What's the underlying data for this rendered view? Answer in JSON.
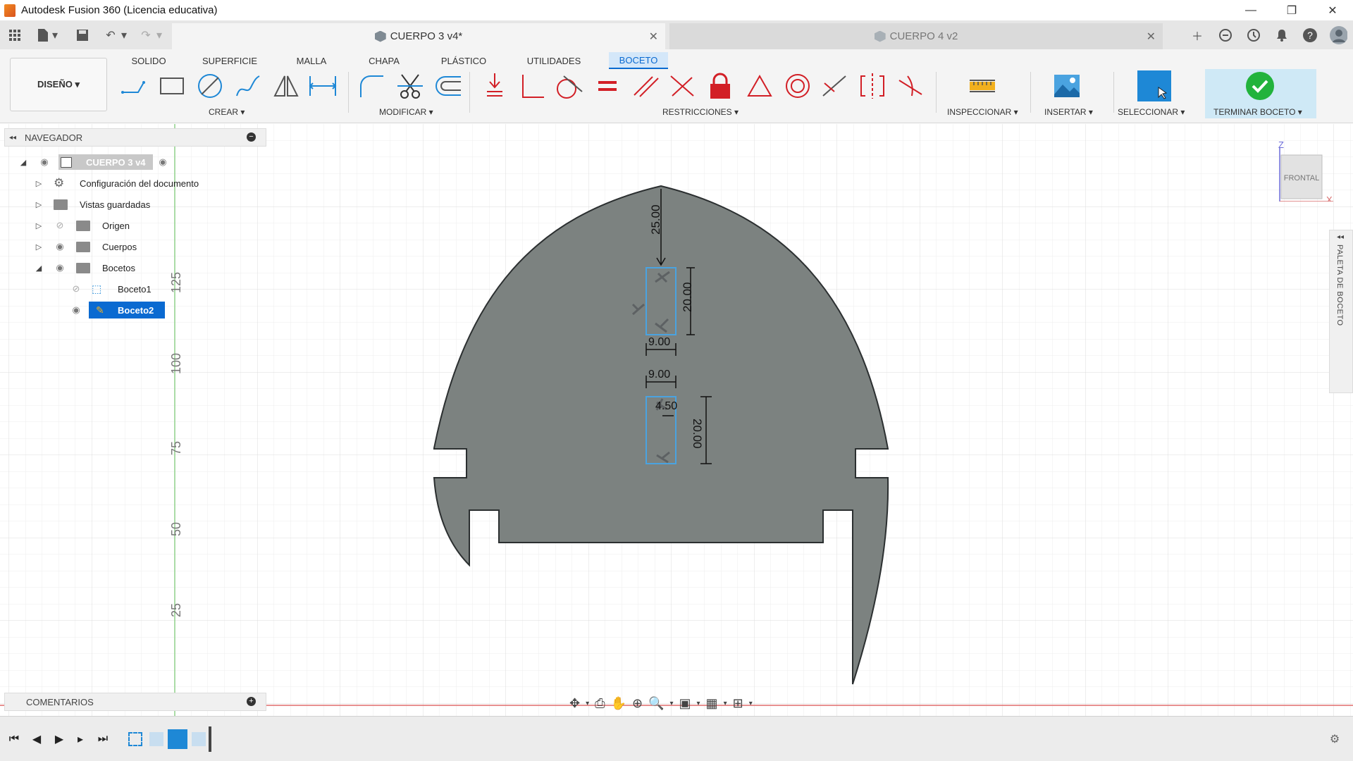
{
  "window": {
    "title": "Autodesk Fusion 360 (Licencia educativa)",
    "minimize": "—",
    "restore": "❐",
    "close": "✕"
  },
  "tabs": [
    {
      "label": "CUERPO 3 v4*",
      "active": true
    },
    {
      "label": "CUERPO 4 v2",
      "active": false
    }
  ],
  "ribbon": {
    "workspace": "DISEÑO ▾",
    "tabs": [
      "SOLIDO",
      "SUPERFICIE",
      "MALLA",
      "CHAPA",
      "PLÁSTICO",
      "UTILIDADES",
      "BOCETO"
    ],
    "active_tab": "BOCETO",
    "groups": {
      "crear": "CREAR ▾",
      "modificar": "MODIFICAR ▾",
      "restricciones": "RESTRICCIONES ▾",
      "inspeccionar": "INSPECCIONAR ▾",
      "insertar": "INSERTAR ▾",
      "seleccionar": "SELECCIONAR ▾",
      "terminar": "TERMINAR BOCETO ▾"
    }
  },
  "navigator": {
    "title": "NAVEGADOR",
    "root": "CUERPO 3 v4",
    "items": [
      {
        "label": "Configuración del documento"
      },
      {
        "label": "Vistas guardadas"
      },
      {
        "label": "Origen"
      },
      {
        "label": "Cuerpos"
      },
      {
        "label": "Bocetos"
      },
      {
        "label": "Boceto1"
      },
      {
        "label": "Boceto2"
      }
    ]
  },
  "comments": {
    "title": "COMENTARIOS"
  },
  "palette": {
    "title": "PALETA DE BOCETO"
  },
  "viewcube": {
    "face": "FRONTAL",
    "z": "Z",
    "x": "X"
  },
  "ruler": {
    "ticks": [
      "125",
      "100",
      "75",
      "50",
      "25"
    ]
  },
  "dimensions": {
    "d1": "25.00",
    "d2": "20.00",
    "d3": "9.00",
    "d4": "9.00",
    "d5": "4.50",
    "d6": "20.00"
  },
  "colors": {
    "accent": "#0a6ad1",
    "sketch_fill": "#7c8280",
    "finish_green": "#22b33c"
  }
}
